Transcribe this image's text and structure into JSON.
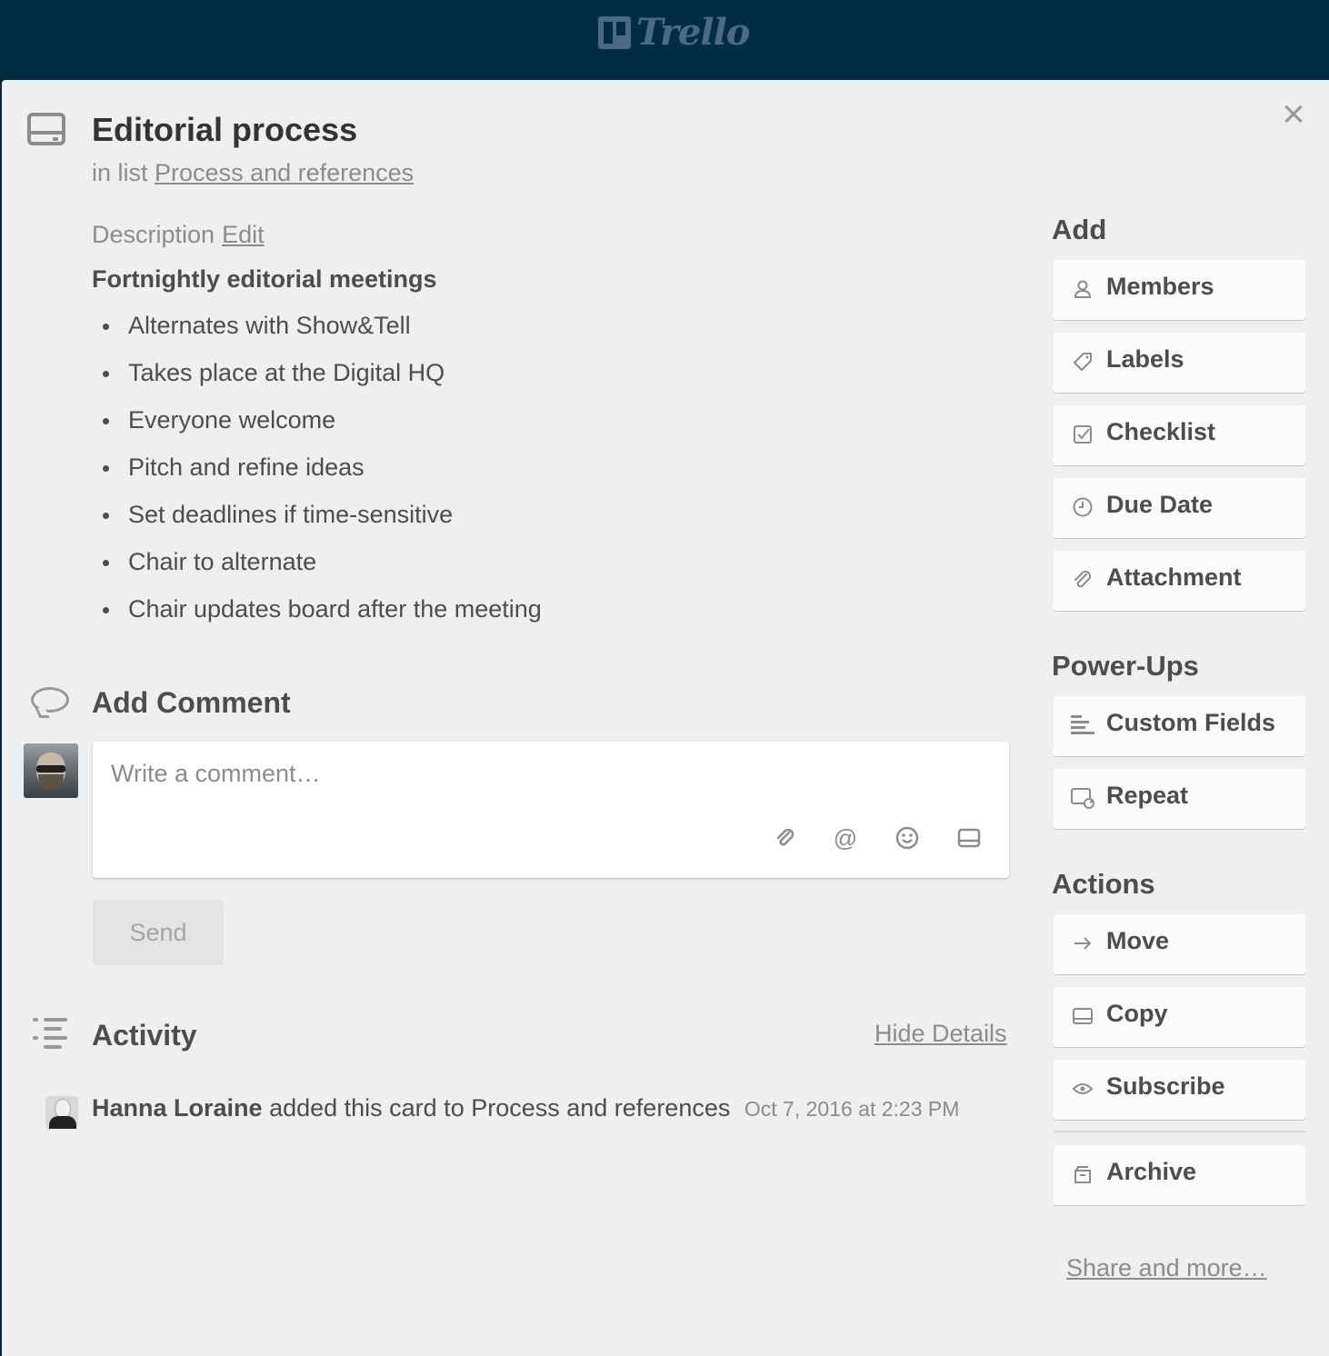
{
  "app": {
    "logo_text": "Trello"
  },
  "card": {
    "title": "Editorial process",
    "in_list_prefix": "in list",
    "list_name": "Process and references"
  },
  "description": {
    "label": "Description",
    "edit_label": "Edit",
    "heading": "Fortnightly editorial meetings",
    "items": [
      "Alternates with Show&Tell",
      "Takes place at the Digital HQ",
      "Everyone welcome",
      "Pitch and refine ideas",
      "Set deadlines if time-sensitive",
      "Chair to alternate",
      "Chair updates board after the meeting"
    ]
  },
  "comment": {
    "heading": "Add Comment",
    "placeholder": "Write a comment…",
    "send_label": "Send"
  },
  "activity": {
    "heading": "Activity",
    "hide_details_label": "Hide Details",
    "entries": [
      {
        "user": "Hanna Loraine",
        "action": "added this card to Process and references",
        "timestamp": "Oct 7, 2016 at 2:23 PM"
      }
    ]
  },
  "sidebar": {
    "add": {
      "heading": "Add",
      "buttons": [
        {
          "label": "Members",
          "icon": "person-icon"
        },
        {
          "label": "Labels",
          "icon": "tag-icon"
        },
        {
          "label": "Checklist",
          "icon": "checkbox-icon"
        },
        {
          "label": "Due Date",
          "icon": "clock-icon"
        },
        {
          "label": "Attachment",
          "icon": "paperclip-icon"
        }
      ]
    },
    "powerups": {
      "heading": "Power-Ups",
      "buttons": [
        {
          "label": "Custom Fields",
          "icon": "custom-fields-icon"
        },
        {
          "label": "Repeat",
          "icon": "repeat-card-icon"
        }
      ]
    },
    "actions": {
      "heading": "Actions",
      "buttons": [
        {
          "label": "Move",
          "icon": "arrow-right-icon"
        },
        {
          "label": "Copy",
          "icon": "card-icon"
        },
        {
          "label": "Subscribe",
          "icon": "eye-icon"
        },
        {
          "label": "Archive",
          "icon": "archive-icon"
        }
      ]
    },
    "share_label": "Share and more…"
  },
  "colors": {
    "header_bg": "#022b44",
    "modal_bg": "#edeff0",
    "text": "#4d4d4d",
    "muted": "#8c8c8c"
  }
}
